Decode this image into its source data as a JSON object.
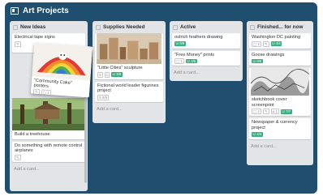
{
  "board": {
    "title": "Art Projects",
    "icon": "board-icon"
  },
  "lists": [
    {
      "title": "New Ideas",
      "cards": [
        {
          "title": "Electrical tape signs"
        },
        {
          "title": "Build a treehouse"
        },
        {
          "title": "Do something with remote control airplanes"
        }
      ],
      "add_card": "Add a card..."
    },
    {
      "title": "Supplies Needed",
      "cards": [
        {
          "title": "\"Little Cities\" sculpture",
          "checklist": "5/9"
        },
        {
          "title": "Fictional world leader figurines project"
        }
      ],
      "add_card": "Add a card..."
    },
    {
      "title": "Active",
      "cards": [
        {
          "title": "ostrich feathers drawing",
          "checklist": "8/9"
        },
        {
          "title": "\"Free Money\" prints",
          "comments": "1",
          "checklist": "3/5"
        }
      ],
      "add_card": "Add a card..."
    },
    {
      "title": "Finished... for now",
      "cards": [
        {
          "title": "Washington DC painting",
          "comments": "2",
          "checklist": "4/4"
        },
        {
          "title": "Goose drawings",
          "checklist": "6/6"
        },
        {
          "title": "sketchbook cover screenprint",
          "comments": "2",
          "attachments": "1",
          "checklist": "7/7"
        },
        {
          "title": "Newspaper & currency project",
          "checklist": "4/4"
        }
      ],
      "add_card": "Add a card..."
    }
  ],
  "dragging_card": {
    "title": "\"Community Cake\" posters",
    "comments": "1"
  },
  "colors": {
    "board_bg": "#1f4e6e",
    "list_bg": "#e2e4e6",
    "label_green": "#34b27d"
  }
}
